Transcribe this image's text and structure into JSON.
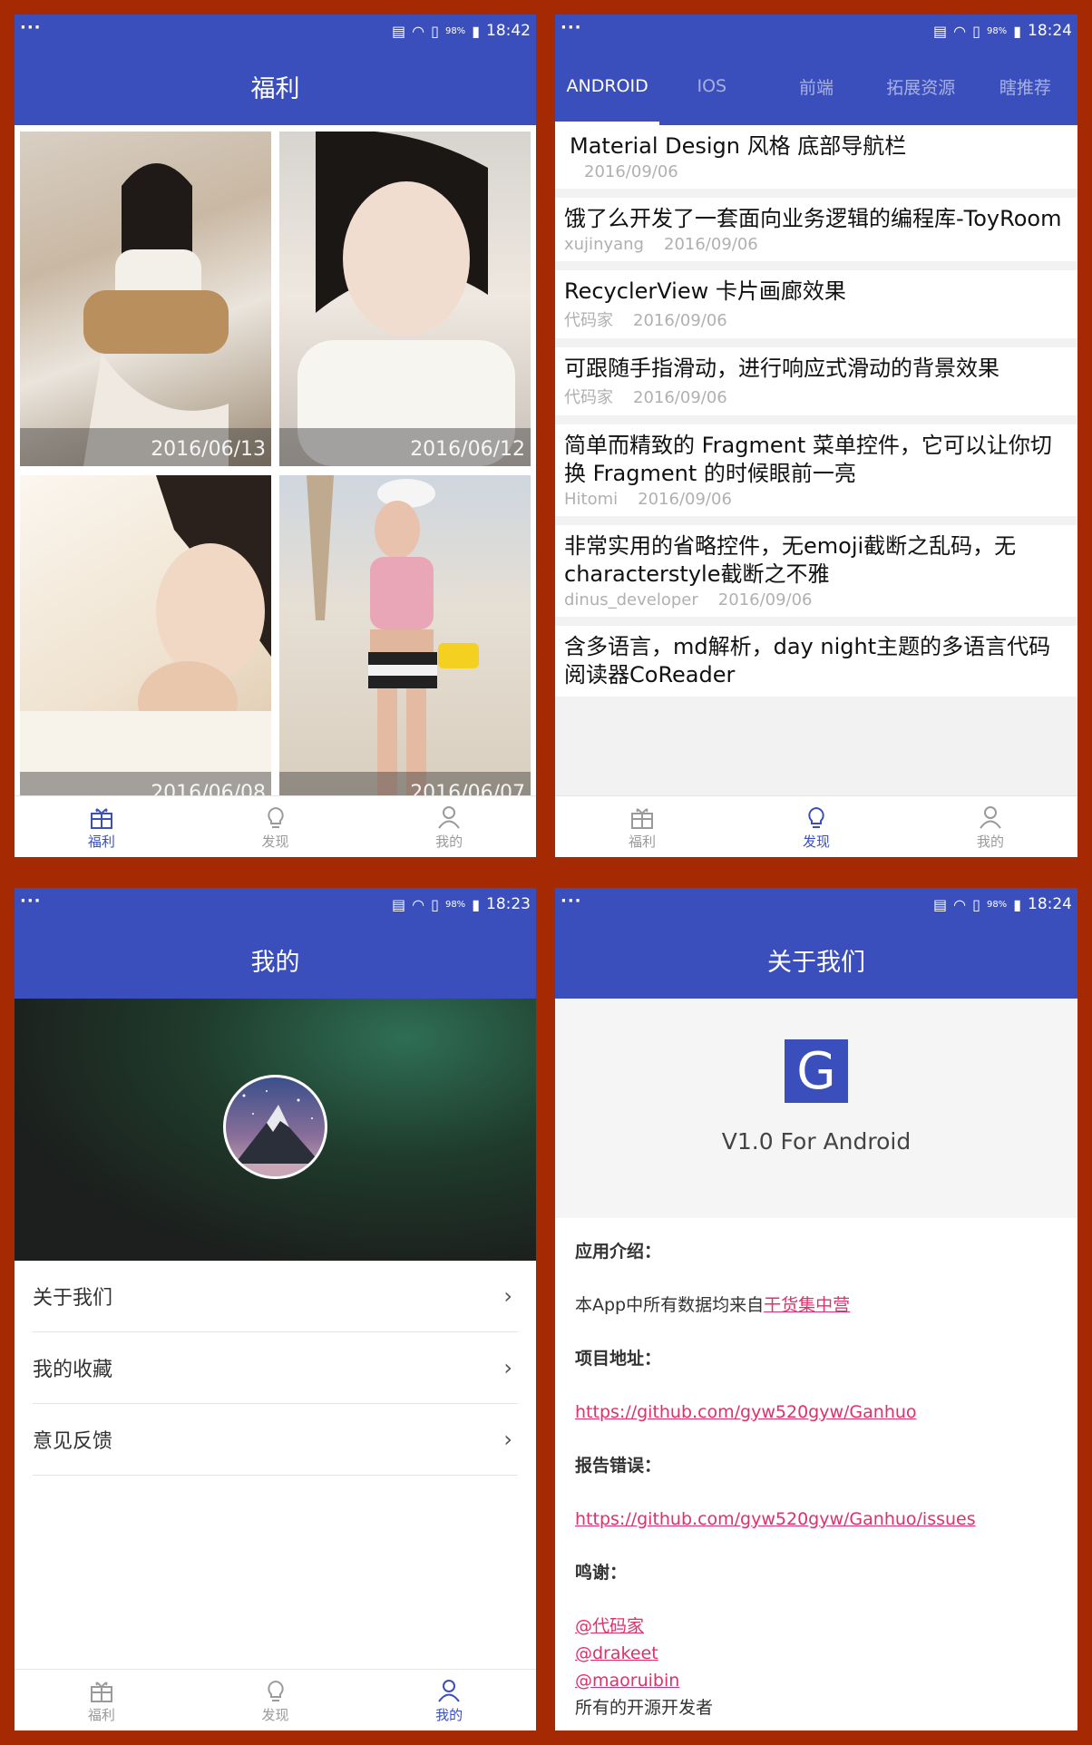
{
  "screen1": {
    "status_time": "18:42",
    "battery": "98%",
    "title": "福利",
    "photos": [
      {
        "date": "2016/06/13"
      },
      {
        "date": "2016/06/12"
      },
      {
        "date": "2016/06/08"
      },
      {
        "date": "2016/06/07"
      }
    ]
  },
  "screen2": {
    "status_time": "18:24",
    "battery": "98%",
    "tabs": [
      "ANDROID",
      "IOS",
      "前端",
      "拓展资源",
      "瞎推荐"
    ],
    "items": [
      {
        "title": "Material Design 风格 底部导航栏",
        "author": "",
        "date": "2016/09/06"
      },
      {
        "title": "饿了么开发了一套面向业务逻辑的编程库-ToyRoom",
        "author": "xujinyang",
        "date": "2016/09/06"
      },
      {
        "title": "RecyclerView 卡片画廊效果",
        "author": "代码家",
        "date": "2016/09/06"
      },
      {
        "title": "可跟随手指滑动，进行响应式滑动的背景效果",
        "author": "代码家",
        "date": "2016/09/06"
      },
      {
        "title": "简单而精致的 Fragment 菜单控件，它可以让你切换 Fragment 的时候眼前一亮",
        "author": "Hitomi",
        "date": "2016/09/06"
      },
      {
        "title": "非常实用的省略控件，无emoji截断之乱码，无characterstyle截断之不雅",
        "author": "dinus_developer",
        "date": "2016/09/06"
      },
      {
        "title": "含多语言，md解析，day night主题的多语言代码阅读器CoReader",
        "author": "",
        "date": ""
      }
    ]
  },
  "screen3": {
    "status_time": "18:23",
    "battery": "98%",
    "title": "我的",
    "menu": [
      "关于我们",
      "我的收藏",
      "意见反馈"
    ]
  },
  "screen4": {
    "status_time": "18:24",
    "battery": "98%",
    "title": "关于我们",
    "logo_letter": "G",
    "version": "V1.0 For Android",
    "intro_heading": "应用介绍：",
    "intro_text": "本App中所有数据均来自",
    "intro_link": "干货集中营",
    "project_heading": "项目地址：",
    "project_url": "https://github.com/gyw520gyw/Ganhuo",
    "issues_heading": "报告错误：",
    "issues_url": "https://github.com/gyw520gyw/Ganhuo/issues",
    "thanks_heading": "鸣谢：",
    "thanks": [
      "@代码家",
      "@drakeet",
      "@maoruibin"
    ],
    "thanks_all": "所有的开源开发者"
  },
  "nav": {
    "welfare": "福利",
    "discover": "发现",
    "mine": "我的"
  },
  "colors": {
    "primary": "#3b4fbc",
    "frame": "#a52a04",
    "link": "#e0306a"
  }
}
